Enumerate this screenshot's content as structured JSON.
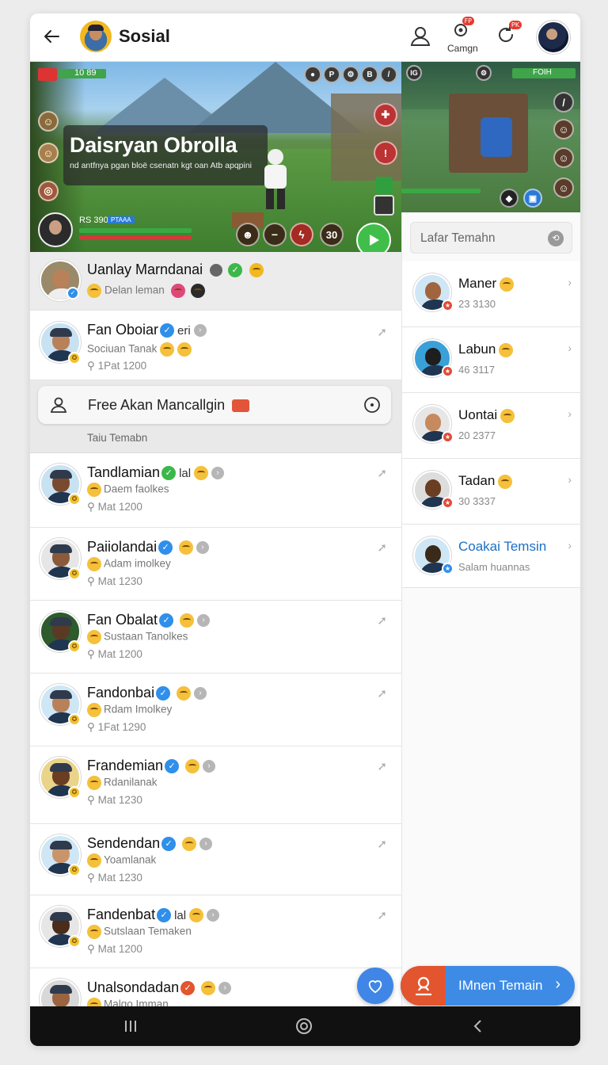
{
  "header": {
    "title": "Sosial",
    "camera_label": "Camgn",
    "badge1": "FP",
    "badge2": "PK"
  },
  "game": {
    "title": "Daisryan Obrolla",
    "subtitle": "nd antfnya pgan bloë csenatn kgt oan Atb apqpini",
    "hud_top_left": "10 89",
    "hud_bottom_left": "RS 390",
    "hud_bottom_tag": "PTAAA",
    "btn_p": "P",
    "btn_b": "B",
    "btn_ig": "IG",
    "btn_30": "30",
    "right_hud": "FOIH"
  },
  "featured": {
    "name": "Uanlay Marndanai",
    "sub": "Delan leman"
  },
  "contacts_top": [
    {
      "name": "Fan Oboiar",
      "tag": "eri",
      "sub": "Sociuan Tanak",
      "meta": "1Pat 1200"
    }
  ],
  "search": {
    "text": "Free Akan Mancallgin",
    "section_label": "Taiu Temabn"
  },
  "contacts": [
    {
      "name": "Tandlamian",
      "tag": "lal",
      "sub": "Daem faolkes",
      "meta": "Mat 1200",
      "verify": "green"
    },
    {
      "name": "Paiiolandai",
      "tag": "",
      "sub": "Adam imolkey",
      "meta": "Mat 1230",
      "verify": "blue"
    },
    {
      "name": "Fan Obalat",
      "tag": "",
      "sub": "Sustaan Tanolkes",
      "meta": "Mat 1200",
      "verify": "blue"
    },
    {
      "name": "Fandonbai",
      "tag": "",
      "sub": "Rdam Imolkey",
      "meta": "1Fat 1290",
      "verify": "blue"
    },
    {
      "name": "Frandemian",
      "tag": "",
      "sub": "Rdanilanak",
      "meta": "Mat 1230",
      "verify": "blue"
    },
    {
      "name": "Sendendan",
      "tag": "",
      "sub": "Yoamlanak",
      "meta": "Mat 1230",
      "verify": "blue"
    },
    {
      "name": "Fandenbat",
      "tag": "lal",
      "sub": "Sutslaan Temaken",
      "meta": "Mat 1200",
      "verify": "blue"
    },
    {
      "name": "Unalsondadan",
      "tag": "",
      "sub": "Malgo Imman",
      "meta": "",
      "verify": "red"
    }
  ],
  "right_panel": {
    "search_placeholder": "Lafar Temahn",
    "items": [
      {
        "name": "Maner",
        "sub": "23 3130"
      },
      {
        "name": "Labun",
        "sub": "46 3117"
      },
      {
        "name": "Uontai",
        "sub": "20 2377"
      },
      {
        "name": "Tadan",
        "sub": "30 3337"
      },
      {
        "name": "Coakai Temsin",
        "sub": "Salam huannas",
        "accent": "#1c6fc4"
      }
    ]
  },
  "fab": {
    "add_label": "IMnen Temain"
  },
  "colors": {
    "accent_blue": "#3e8be6",
    "accent_orange": "#e2552e",
    "verify_blue": "#2f8fea",
    "green": "#3cb84a"
  }
}
